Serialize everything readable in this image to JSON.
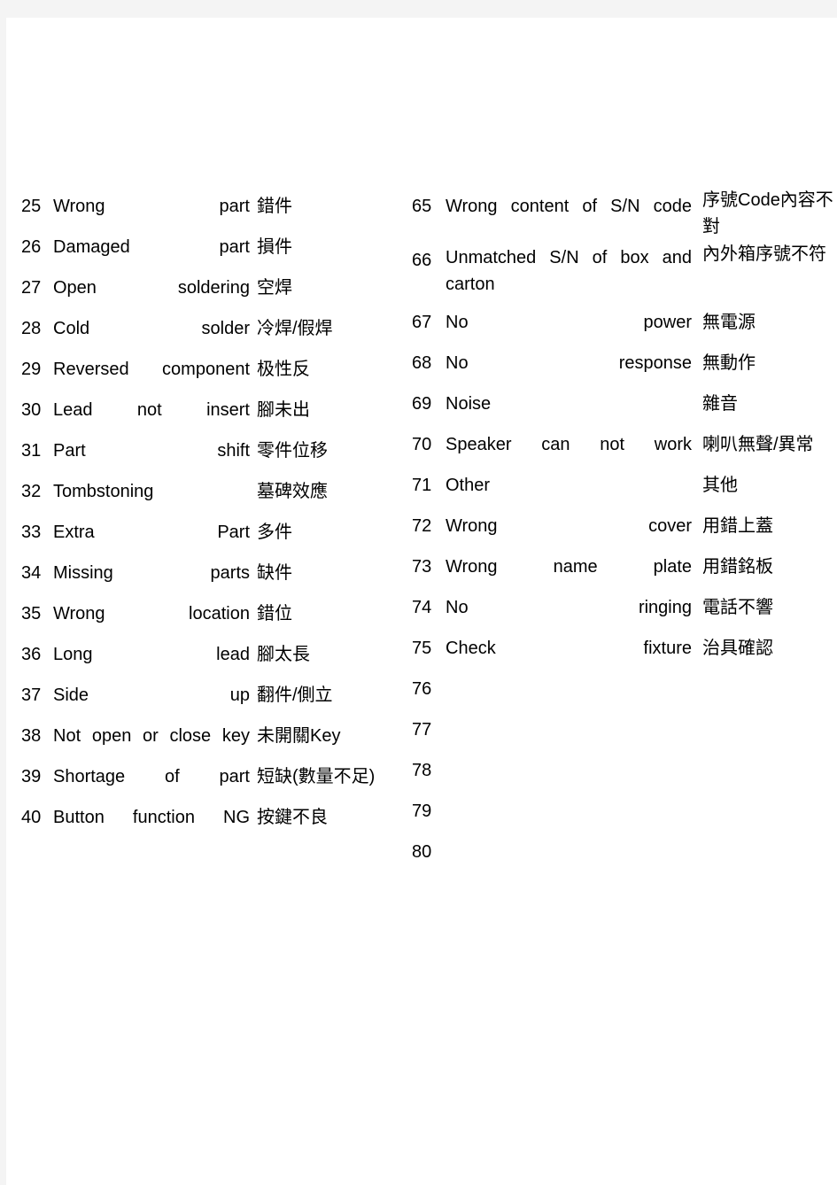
{
  "document": {
    "type": "defect-code-reference-table",
    "columns": 2,
    "header_visible": false
  },
  "left_column": {
    "rows": [
      {
        "no": "25",
        "en": "Wrong part",
        "zh": "錯件"
      },
      {
        "no": "26",
        "en": "Damaged part",
        "zh": "損件"
      },
      {
        "no": "27",
        "en": "Open soldering",
        "zh": "空焊"
      },
      {
        "no": "28",
        "en": "Cold solder",
        "zh": "冷焊/假焊"
      },
      {
        "no": "29",
        "en": "Reversed component",
        "zh": "极性反"
      },
      {
        "no": "30",
        "en": "Lead not insert",
        "zh": "腳未出"
      },
      {
        "no": "31",
        "en": "Part shift",
        "zh": "零件位移"
      },
      {
        "no": "32",
        "en": "Tombstoning",
        "zh": "墓碑效應"
      },
      {
        "no": "33",
        "en": "Extra Part",
        "zh": "多件"
      },
      {
        "no": "34",
        "en": "Missing parts",
        "zh": "缺件"
      },
      {
        "no": "35",
        "en": "Wrong location",
        "zh": "錯位"
      },
      {
        "no": "36",
        "en": "Long lead",
        "zh": "腳太長"
      },
      {
        "no": "37",
        "en": "Side up",
        "zh": "翻件/側立"
      },
      {
        "no": "38",
        "en": "Not open or close key",
        "zh": "未開關Key"
      },
      {
        "no": "39",
        "en": "Shortage of part",
        "zh": "短缺(數量不足)"
      },
      {
        "no": "40",
        "en": "Button function NG",
        "zh": "按鍵不良"
      }
    ]
  },
  "right_column": {
    "rows": [
      {
        "no": "65",
        "en": "Wrong content of S/N code",
        "zh": "序號Code內容不對"
      },
      {
        "no": "66",
        "en": "Unmatched S/N of box and carton",
        "zh": "內外箱序號不符"
      },
      {
        "no": "67",
        "en": "No power",
        "zh": "無電源"
      },
      {
        "no": "68",
        "en": "No response",
        "zh": "無動作"
      },
      {
        "no": "69",
        "en": "Noise",
        "zh": "雜音"
      },
      {
        "no": "70",
        "en": "Speaker can not work",
        "zh": "喇叭無聲/異常"
      },
      {
        "no": "71",
        "en": "Other",
        "zh": "其他"
      },
      {
        "no": "72",
        "en": "Wrong cover",
        "zh": "用錯上蓋"
      },
      {
        "no": "73",
        "en": "Wrong name plate",
        "zh": "用錯銘板"
      },
      {
        "no": "74",
        "en": "No ringing",
        "zh": "電話不響"
      },
      {
        "no": "75",
        "en": "Check fixture",
        "zh": "治具確認"
      },
      {
        "no": "76",
        "en": "",
        "zh": ""
      },
      {
        "no": "77",
        "en": "",
        "zh": ""
      },
      {
        "no": "78",
        "en": "",
        "zh": ""
      },
      {
        "no": "79",
        "en": "",
        "zh": ""
      },
      {
        "no": "80",
        "en": "",
        "zh": ""
      }
    ]
  },
  "colors": {
    "page_background": "#ffffff",
    "canvas_background": "#f4f4f4",
    "text": "#000000"
  }
}
